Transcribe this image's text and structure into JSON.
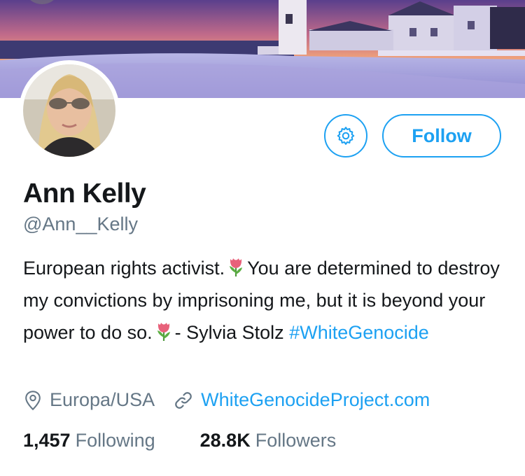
{
  "profile": {
    "name": "Ann Kelly",
    "handle": "@Ann__Kelly",
    "bio_parts": {
      "p1": "European rights activist.",
      "p2": "You are determined to destroy my convictions by imprisoning me, but it is beyond your power to do so.",
      "p3": "- Sylvia Stolz",
      "hashtag": "#WhiteGenocide"
    },
    "location": "Europa/USA",
    "website": "WhiteGenocideProject.com"
  },
  "actions": {
    "follow_label": "Follow",
    "settings_icon": "gear-icon"
  },
  "stats": {
    "following_count": "1,457",
    "following_label": "Following",
    "followers_count": "28.8K",
    "followers_label": "Followers"
  },
  "colors": {
    "accent": "#1da1f2",
    "secondary_text": "#657786",
    "primary_text": "#14171a"
  },
  "icons": {
    "location": "location-pin-icon",
    "link": "link-icon",
    "emoji": "tulip-emoji-icon"
  }
}
